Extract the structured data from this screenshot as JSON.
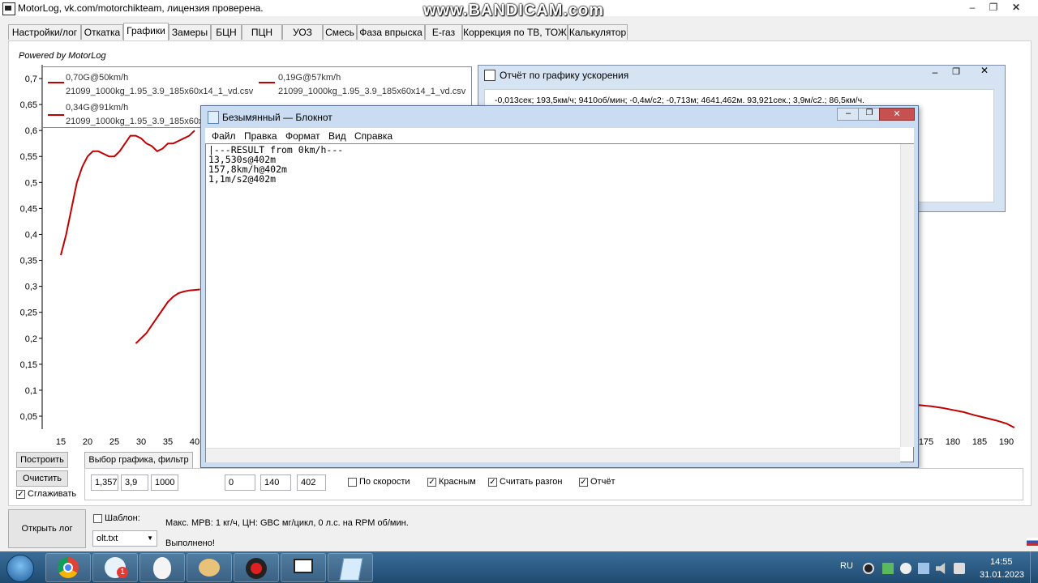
{
  "window": {
    "title": "MotorLog, vk.com/motorchikteam, лицензия проверена.",
    "watermark": "www.BANDICAM.com"
  },
  "tabs": [
    "Настройки/лог",
    "Откатка",
    "Графики",
    "Замеры",
    "БЦН",
    "ПЦН",
    "УОЗ",
    "Смесь",
    "Фаза впрыска",
    "E-газ",
    "Коррекция по ТВ, ТОЖ",
    "Калькулятор"
  ],
  "active_tab": "Графики",
  "powered_by": "Powered by MotorLog",
  "chart_data": {
    "type": "line",
    "y_ticks": [
      "0,7",
      "0,65",
      "0,6",
      "0,55",
      "0,5",
      "0,45",
      "0,4",
      "0,35",
      "0,3",
      "0,25",
      "0,2",
      "0,15",
      "0,1",
      "0,05"
    ],
    "x_ticks": [
      "15",
      "20",
      "25",
      "30",
      "35",
      "40",
      "175",
      "180",
      "185",
      "190"
    ],
    "grid": false,
    "legend_placement": "top-left",
    "legend": [
      {
        "value": "0,70G@50km/h",
        "file": "21099_1000kg_1.95_3.9_185x60x14_1_vd.csv"
      },
      {
        "value": "0,19G@57km/h",
        "file": "21099_1000kg_1.95_3.9_185x60x14_1_vd.csv"
      },
      {
        "value": "0,34G@91km/h",
        "file": "21099_1000kg_1.95_3.9_185x60x14_1_vd.csv"
      }
    ],
    "series": [
      {
        "color": "#c00000",
        "x": [
          15,
          16,
          17,
          18,
          19,
          20,
          21,
          22,
          23,
          24,
          25,
          26,
          27,
          28,
          29,
          30,
          31,
          32,
          33,
          34,
          35,
          36,
          37,
          38,
          39,
          40
        ],
        "y": [
          0.36,
          0.4,
          0.45,
          0.5,
          0.53,
          0.55,
          0.56,
          0.56,
          0.555,
          0.55,
          0.55,
          0.56,
          0.575,
          0.59,
          0.59,
          0.585,
          0.575,
          0.57,
          0.56,
          0.565,
          0.575,
          0.575,
          0.58,
          0.585,
          0.59,
          0.6
        ]
      },
      {
        "color": "#c00000",
        "x": [
          29,
          30,
          31,
          32,
          33,
          34,
          35,
          36,
          37,
          38,
          39,
          40,
          41
        ],
        "y": [
          0.19,
          0.2,
          0.21,
          0.225,
          0.24,
          0.255,
          0.27,
          0.28,
          0.287,
          0.29,
          0.292,
          0.293,
          0.294
        ]
      },
      {
        "color": "#c00000",
        "x": [
          170,
          172,
          174,
          176,
          178,
          180,
          182,
          184,
          186,
          188,
          190,
          191.5
        ],
        "y": [
          0.075,
          0.073,
          0.071,
          0.069,
          0.066,
          0.062,
          0.058,
          0.052,
          0.047,
          0.042,
          0.036,
          0.028
        ]
      }
    ]
  },
  "controls": {
    "build_button": "Построить",
    "clear_button": "Очистить",
    "smooth_label": "Сглаживать",
    "select_graph_tab": "Выбор графика, фильтр",
    "field1": "1,357",
    "field2": "3,9",
    "field3": "1000",
    "field4": "0",
    "field5": "140",
    "field6": "402",
    "by_speed_label": "По скорости",
    "red_label": "Красным",
    "count_accel_label": "Считать разгон",
    "report_label": "Отчёт",
    "open_log_button": "Открыть лог",
    "template_label": "Шаблон:",
    "template_value": "olt.txt",
    "info_line": "Макс. МРВ: 1 кг/ч, ЦН: GBC мг/цикл, 0 л.с. на RPM об/мин.",
    "status": "Выполнено!"
  },
  "report_window": {
    "title": "Отчёт по графику ускорения",
    "line1": "-0,013сек; 193,5км/ч; 9410об/мин; -0,4м/с2; -0,713м; 4641,462м. 93,921сек.; 3,9м/с2.; 86,5км/ч."
  },
  "notepad": {
    "title": "Безымянный — Блокнот",
    "menu": [
      "Файл",
      "Правка",
      "Формат",
      "Вид",
      "Справка"
    ],
    "text": "|---RESULT from 0km/h---\n13,530s@402m\n157,8km/h@402m\n1,1m/s2@402m"
  },
  "taskbar": {
    "lang": "RU",
    "time": "14:55",
    "date": "31.01.2023",
    "badge": "1"
  }
}
